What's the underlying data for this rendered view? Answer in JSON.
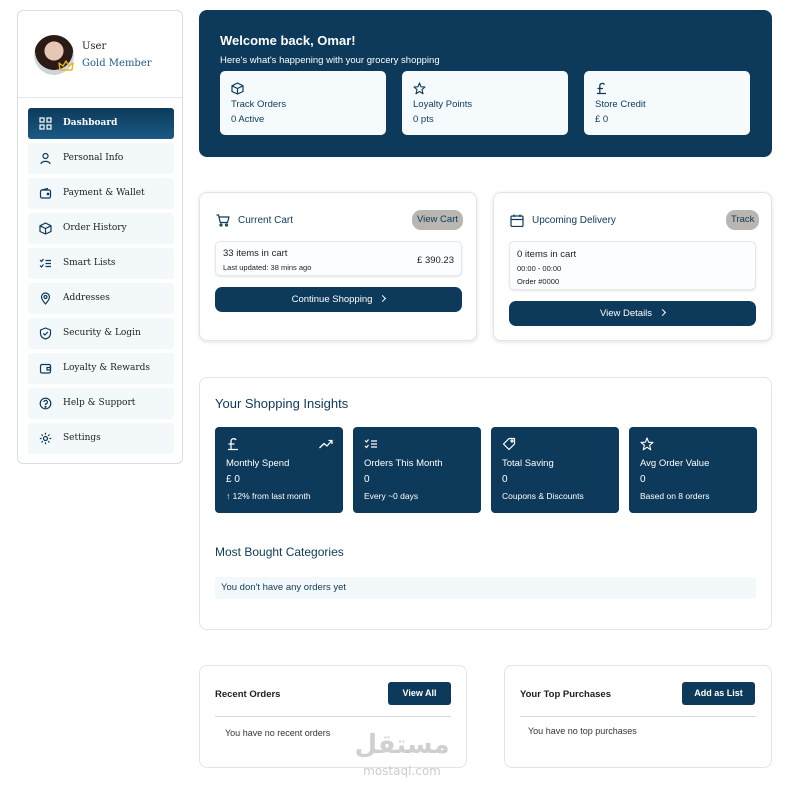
{
  "user": {
    "name": "User",
    "tier": "Gold Member"
  },
  "sidebar": {
    "items": [
      {
        "label": "Dashboard",
        "icon": "grid-icon",
        "active": true
      },
      {
        "label": "Personal Info",
        "icon": "user-icon"
      },
      {
        "label": "Payment & Wallet",
        "icon": "wallet-icon"
      },
      {
        "label": "Order History",
        "icon": "box-icon"
      },
      {
        "label": "Smart Lists",
        "icon": "checklist-icon"
      },
      {
        "label": "Addresses",
        "icon": "location-pin-icon"
      },
      {
        "label": "Security & Login",
        "icon": "shield-icon"
      },
      {
        "label": "Loyalty & Rewards",
        "icon": "card-icon"
      },
      {
        "label": "Help & Support",
        "icon": "help-icon"
      },
      {
        "label": "Settings",
        "icon": "gear-icon"
      }
    ]
  },
  "welcome": {
    "title": "Welcome back, Omar!",
    "subtitle": "Here's what's happening with your grocery shopping",
    "cards": [
      {
        "title": "Track Orders",
        "value": "0 Active",
        "icon": "box-icon"
      },
      {
        "title": "Loyalty Points",
        "value": "0 pts",
        "icon": "star-icon"
      },
      {
        "title": "Store Credit",
        "value": "£ 0",
        "icon": "pound-icon"
      }
    ]
  },
  "cart": {
    "title": "Current Cart",
    "action": "View Cart",
    "items": "33 items in cart",
    "updated": "Last updated: 38 mins ago",
    "total": "£ 390.23",
    "button": "Continue Shopping"
  },
  "delivery": {
    "title": "Upcoming Delivery",
    "action": "Track",
    "items": "0 items in cart",
    "time": "00:00 - 00:00",
    "order": "Order #0000",
    "button": "View Details"
  },
  "insights": {
    "title": "Your Shopping Insights",
    "cards": [
      {
        "title": "Monthly Spend",
        "value": "£ 0",
        "note": "↑ 12% from last month",
        "icon": "pound-icon"
      },
      {
        "title": "Orders This Month",
        "value": "0",
        "note": "Every ~0 days",
        "icon": "checklist-icon"
      },
      {
        "title": "Total Saving",
        "value": "0",
        "note": "Coupons & Discounts",
        "icon": "tag-icon"
      },
      {
        "title": "Avg Order Value",
        "value": "0",
        "note": "Based on 8 orders",
        "icon": "star-icon"
      }
    ],
    "categories_title": "Most Bought Categories",
    "categories_empty": "You don't have any orders yet"
  },
  "recent_orders": {
    "title": "Recent Orders",
    "button": "View All",
    "empty": "You have no recent orders"
  },
  "top_purchases": {
    "title": "Your Top Purchases",
    "button": "Add as List",
    "empty": "You have no top purchases"
  },
  "watermark": {
    "arabic": "مستقل",
    "latin": "mostaql.com"
  },
  "colors": {
    "primary": "#0d3a5a",
    "pill": "#b9b6b1",
    "light": "#f3f8fb",
    "crown": "#e6b422"
  }
}
